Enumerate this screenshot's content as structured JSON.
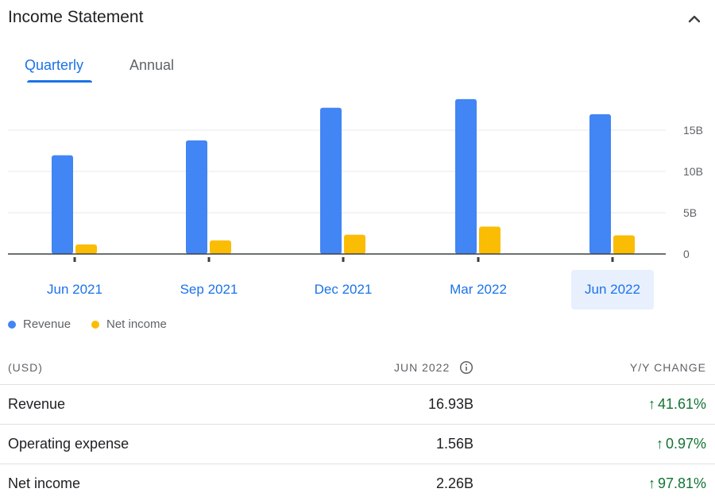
{
  "header": {
    "title": "Income Statement",
    "collapse_icon": "chevron-up-icon"
  },
  "tabs": [
    {
      "label": "Quarterly",
      "active": true
    },
    {
      "label": "Annual",
      "active": false
    }
  ],
  "chart_data": {
    "type": "bar",
    "categories": [
      "Jun 2021",
      "Sep 2021",
      "Dec 2021",
      "Mar 2022",
      "Jun 2022"
    ],
    "selected_category": "Jun 2022",
    "series": [
      {
        "name": "Revenue",
        "color": "#4285f4",
        "values": [
          11.96,
          13.76,
          17.72,
          18.76,
          16.93
        ]
      },
      {
        "name": "Net income",
        "color": "#fbbc04",
        "values": [
          1.15,
          1.65,
          2.33,
          3.32,
          2.26
        ]
      }
    ],
    "y_ticks": [
      {
        "value": 0,
        "label": "0"
      },
      {
        "value": 5,
        "label": "5B"
      },
      {
        "value": 10,
        "label": "10B"
      },
      {
        "value": 15,
        "label": "15B"
      }
    ],
    "ylim": [
      0,
      20
    ],
    "y_axis_side": "right",
    "grid": true,
    "legend_position": "bottom-left"
  },
  "table": {
    "headers": {
      "label": "(USD)",
      "period": "JUN 2022",
      "change": "Y/Y CHANGE"
    },
    "info_icon": "info-icon",
    "rows": [
      {
        "label": "Revenue",
        "value": "16.93B",
        "change": "41.61%",
        "direction": "up"
      },
      {
        "label": "Operating expense",
        "value": "1.56B",
        "change": "0.97%",
        "direction": "up"
      },
      {
        "label": "Net income",
        "value": "2.26B",
        "change": "97.81%",
        "direction": "up"
      }
    ]
  },
  "colors": {
    "accent": "#1a73e8",
    "positive": "#137333",
    "revenue": "#4285f4",
    "net_income": "#fbbc04"
  }
}
